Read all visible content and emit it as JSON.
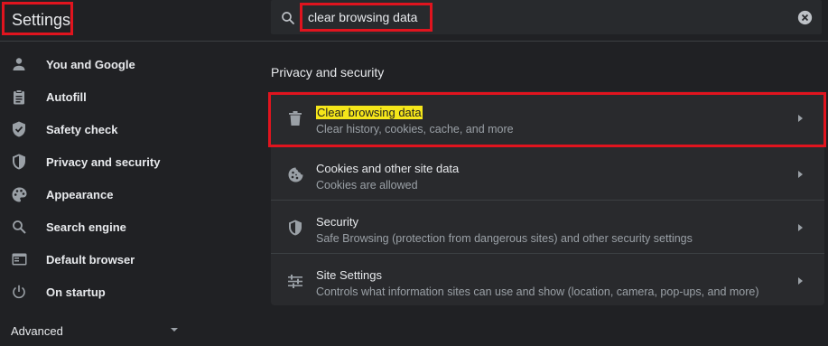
{
  "header": {
    "title": "Settings",
    "search_value": "clear browsing data",
    "search_icon": "search-icon",
    "clear_icon": "clear-search-icon"
  },
  "sidebar": {
    "items": [
      {
        "label": "You and Google",
        "icon": "person-icon"
      },
      {
        "label": "Autofill",
        "icon": "clipboard-icon"
      },
      {
        "label": "Safety check",
        "icon": "shield-check-icon"
      },
      {
        "label": "Privacy and security",
        "icon": "shield-icon"
      },
      {
        "label": "Appearance",
        "icon": "palette-icon"
      },
      {
        "label": "Search engine",
        "icon": "search-icon"
      },
      {
        "label": "Default browser",
        "icon": "browser-icon"
      },
      {
        "label": "On startup",
        "icon": "power-icon"
      }
    ],
    "advanced_label": "Advanced"
  },
  "main": {
    "section_title": "Privacy and security",
    "rows": [
      {
        "title": "Clear browsing data",
        "subtitle": "Clear history, cookies, cache, and more",
        "icon": "trash-icon"
      },
      {
        "title": "Cookies and other site data",
        "subtitle": "Cookies are allowed",
        "icon": "cookie-icon"
      },
      {
        "title": "Security",
        "subtitle": "Safe Browsing (protection from dangerous sites) and other security settings",
        "icon": "shield-icon"
      },
      {
        "title": "Site Settings",
        "subtitle": "Controls what information sites can use and show (location, camera, pop-ups, and more)",
        "icon": "tune-icon"
      }
    ]
  },
  "colors": {
    "background": "#202124",
    "card": "#292a2d",
    "highlight": "#f5e61a",
    "annotation_red": "#e0141e"
  }
}
